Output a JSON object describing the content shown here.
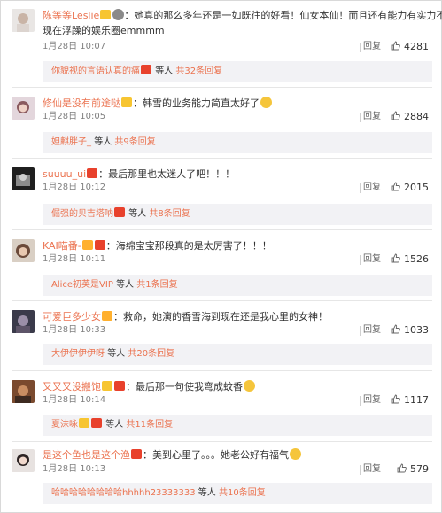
{
  "comments": [
    {
      "user": "陈等等Leslie",
      "text1": "：她真的那么多年还是一如既往的好看！仙女本仙！而且还有能力有实力不像",
      "text2": "现在浮躁的娱乐圈emmmm",
      "date": "1月28日 10:07",
      "reply": "回复",
      "likes": "4281",
      "sub_user": "你貌视的言语认真的痛",
      "sub_mid": "等人",
      "sub_total": "共32条回复"
    },
    {
      "user": "修仙是没有前途哒",
      "text1": "：韩雪的业务能力简直太好了",
      "date": "1月28日 10:05",
      "reply": "回复",
      "likes": "2884",
      "sub_user": "妲麒胖子_",
      "sub_mid": "等人",
      "sub_total": "共9条回复"
    },
    {
      "user": "suuuu_ui",
      "text1": "：最后那里也太迷人了吧！！！",
      "date": "1月28日 10:12",
      "reply": "回复",
      "likes": "2015",
      "sub_user": "倔强的贝吉塔呐",
      "sub_mid": "等人",
      "sub_total": "共8条回复"
    },
    {
      "user": "KAI喵番-",
      "text1": "：海绵宝宝那段真的是太厉害了！！！",
      "date": "1月28日 10:11",
      "reply": "回复",
      "likes": "1526",
      "sub_user": "Alice初英是VIP",
      "sub_mid": "等人",
      "sub_total": "共1条回复"
    },
    {
      "user": "可爱巨多少女",
      "text1": "：救命，她演的香雪海到现在还是我心里的女神！",
      "date": "1月28日 10:33",
      "reply": "回复",
      "likes": "1033",
      "sub_user": "大伊伊伊伊呀",
      "sub_mid": "等人",
      "sub_total": "共20条回复"
    },
    {
      "user": "又又又没搬饱",
      "text1": "：最后那一句使我弯成蚊香",
      "date": "1月28日 10:14",
      "reply": "回复",
      "likes": "1117",
      "sub_user": "夏沫咏",
      "sub_mid": "等人",
      "sub_total": "共11条回复"
    },
    {
      "user": "是这个鱼也是这个渔",
      "text1": "：美到心里了。。。她老公好有福气",
      "date": "1月28日 10:13",
      "reply": "回复",
      "likes": "579",
      "sub_user": "哈哈哈哈哈哈哈哈hhhhh23333333",
      "sub_mid": "等人",
      "sub_total": "共10条回复"
    }
  ],
  "colors": {
    "username": "#eb7350",
    "text": "#333333",
    "meta": "#808080",
    "subbox_bg": "#f2f2f5"
  },
  "icons": {
    "like": "thumbs-up-icon",
    "vip_badge": "vip-badge-icon",
    "member_badge": "member-badge-icon",
    "emoji": "emoji-icon"
  }
}
